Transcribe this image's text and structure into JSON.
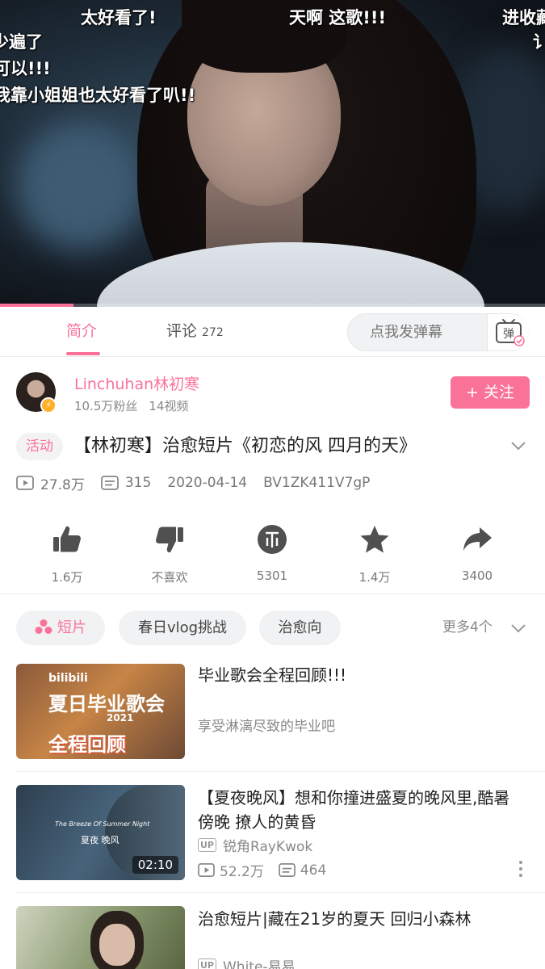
{
  "video": {
    "danmaku": [
      "太好看了!",
      "天啊 这歌!!!",
      "进收藏",
      "少遍了",
      "可以!!!",
      "我靠小姐姐也太好看了叭!!",
      "讠"
    ],
    "progress_fraction": 0.135
  },
  "tabs": [
    {
      "label": "简介",
      "active": true
    },
    {
      "label": "评论",
      "count": "272",
      "active": false
    }
  ],
  "danmaku_input": {
    "placeholder": "点我发弹幕",
    "toggle_label": "弹"
  },
  "uploader": {
    "name": "Linchuhan林初寒",
    "fans": "10.5万粉丝",
    "videos": "14视频",
    "follow_label": "+ 关注"
  },
  "video_info": {
    "activity_tag": "活动",
    "title": "【林初寒】治愈短片《初恋的风 四月的天》",
    "views": "27.8万",
    "danmaku_count": "315",
    "date": "2020-04-14",
    "bvid": "BV1ZK411V7gP"
  },
  "actions": [
    {
      "label": "1.6万",
      "icon": "like-icon"
    },
    {
      "label": "不喜欢",
      "icon": "dislike-icon"
    },
    {
      "label": "5301",
      "icon": "coin-icon"
    },
    {
      "label": "1.4万",
      "icon": "favorite-icon"
    },
    {
      "label": "3400",
      "icon": "share-icon"
    }
  ],
  "tags": [
    "短片",
    "春日vlog挑战",
    "治愈向"
  ],
  "more_tags": "更多4个",
  "related": [
    {
      "title": "毕业歌会全程回顾!!!",
      "subtitle": "享受淋漓尽致的毕业吧",
      "thumb_text": [
        "bilibili",
        "夏日毕业歌会",
        "2021",
        "全程回顾"
      ]
    },
    {
      "title": "【夏夜晚风】想和你撞进盛夏的晚风里,酷暑 傍晚 撩人的黄昏",
      "up_badge": "UP",
      "up_name": "锐角RayKwok",
      "views": "52.2万",
      "danmaku": "464",
      "duration": "02:10",
      "thumb_text": [
        "The Breeze Of Summer Night",
        "夏夜 晚风"
      ]
    },
    {
      "title": "治愈短片|藏在21岁的夏天 回归小森林",
      "up_badge": "UP",
      "up_name": "White-易易"
    }
  ],
  "colors": {
    "accent": "#fb7299",
    "text": "#212121",
    "muted": "#888888"
  }
}
